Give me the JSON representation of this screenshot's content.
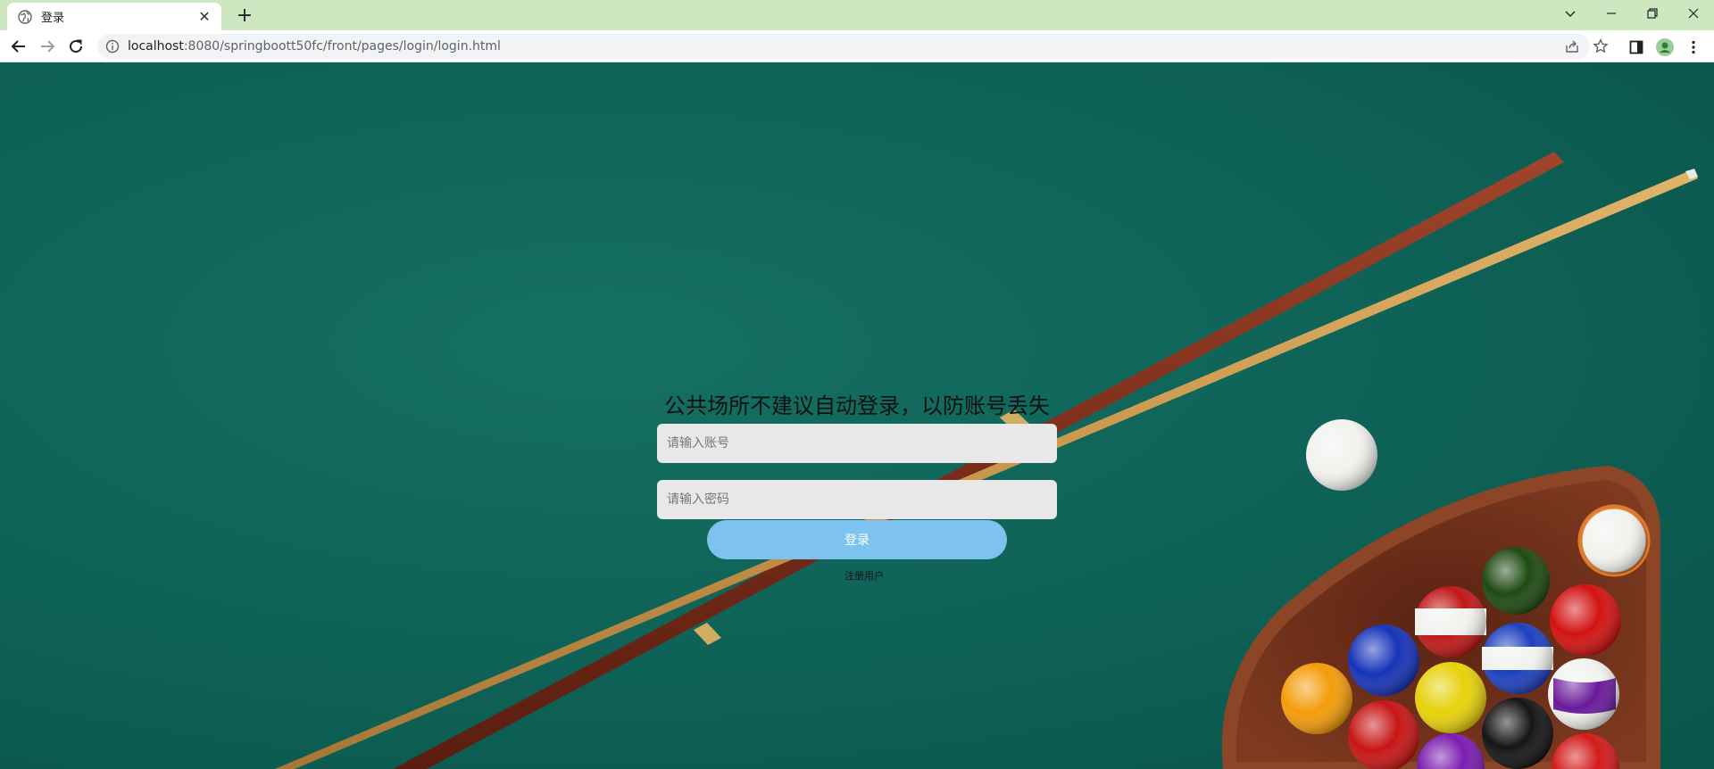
{
  "browser": {
    "tab_title": "登录",
    "tab_close_glyph": "✕",
    "new_tab_glyph": "+",
    "url_host": "localhost",
    "url_path": ":8080/springboott50fc/front/pages/login/login.html"
  },
  "icons": {
    "tab_favicon": "globe-icon",
    "back": "back-arrow-icon",
    "forward": "forward-arrow-icon",
    "reload": "reload-icon",
    "site_info": "info-icon",
    "share": "share-icon",
    "bookmark": "star-icon",
    "side_panel": "side-panel-icon",
    "profile": "profile-icon",
    "menu": "kebab-menu-icon"
  },
  "login": {
    "notice": "公共场所不建议自动登录，以防账号丢失",
    "account_placeholder": "请输入账号",
    "password_placeholder": "请输入密码",
    "login_label": "登录",
    "register_label": "注册用户"
  },
  "colors": {
    "tabbar": "#cde8c0",
    "felt": "#0e6156",
    "login_button": "#7ec2ef",
    "input_bg": "#e8e8e8"
  }
}
